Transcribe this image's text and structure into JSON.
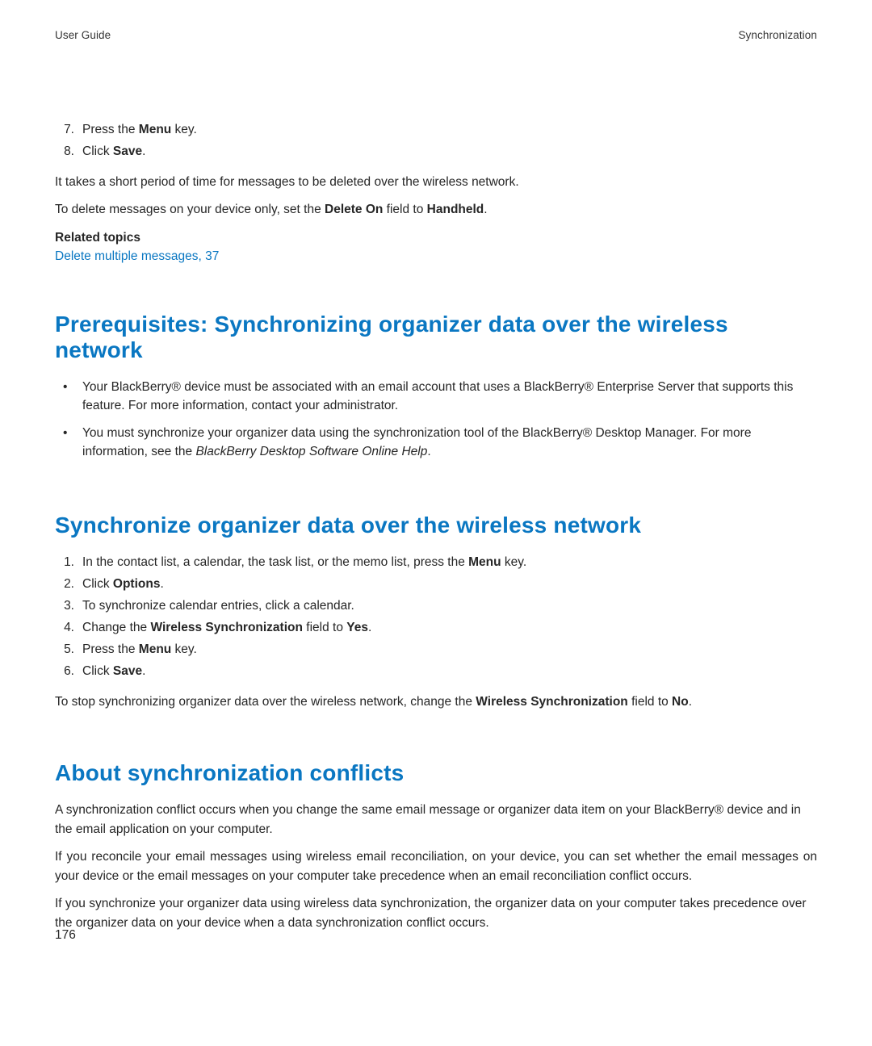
{
  "header": {
    "left": "User Guide",
    "right": "Synchronization"
  },
  "intro": {
    "steps": [
      {
        "num": "7.",
        "pre": "Press the ",
        "bold": "Menu",
        "post": " key."
      },
      {
        "num": "8.",
        "pre": "Click ",
        "bold": "Save",
        "post": "."
      }
    ],
    "p1": "It takes a short period of time for messages to be deleted over the wireless network.",
    "p2_pre": "To delete messages on your device only, set the ",
    "p2_b1": "Delete On",
    "p2_mid": " field to ",
    "p2_b2": "Handheld",
    "p2_post": ".",
    "related_heading": "Related topics",
    "related_link": "Delete multiple messages, 37"
  },
  "sec_prereq": {
    "title": "Prerequisites: Synchronizing organizer data over the wireless network",
    "bullets": [
      {
        "text": "Your BlackBerry® device must be associated with an email account that uses a BlackBerry® Enterprise Server that supports this feature. For more information, contact your administrator."
      },
      {
        "pre": "You must synchronize your organizer data using the synchronization tool of the BlackBerry® Desktop Manager. For more information, see the  ",
        "italic": "BlackBerry Desktop Software Online Help",
        "post": "."
      }
    ]
  },
  "sec_sync": {
    "title": "Synchronize organizer data over the wireless network",
    "steps": [
      {
        "num": "1.",
        "pre": "In the contact list, a calendar, the task list, or the memo list, press the ",
        "bold": "Menu",
        "post": " key."
      },
      {
        "num": "2.",
        "pre": "Click ",
        "bold": "Options",
        "post": "."
      },
      {
        "num": "3.",
        "text": "To synchronize calendar entries, click a calendar."
      },
      {
        "num": "4.",
        "pre": "Change the ",
        "bold": "Wireless Synchronization",
        "mid": " field to ",
        "bold2": "Yes",
        "post": "."
      },
      {
        "num": "5.",
        "pre": "Press the ",
        "bold": "Menu",
        "post": " key."
      },
      {
        "num": "6.",
        "pre": "Click ",
        "bold": "Save",
        "post": "."
      }
    ],
    "p_pre": "To stop synchronizing organizer data over the wireless network, change the ",
    "p_b1": "Wireless Synchronization",
    "p_mid": " field to ",
    "p_b2": "No",
    "p_post": "."
  },
  "sec_conflicts": {
    "title": "About synchronization conflicts",
    "p1": "A synchronization conflict occurs when you change the same email message or organizer data item on your BlackBerry® device and in the email application on your computer.",
    "p2": "If you reconcile your email messages using wireless email reconciliation, on your device, you can set whether the email messages on your device or the email messages on your computer take precedence when an email reconciliation conflict occurs.",
    "p3": "If you synchronize your organizer data using wireless data synchronization, the organizer data on your computer takes precedence over the organizer data on your device when a data synchronization conflict occurs."
  },
  "page_number": "176"
}
